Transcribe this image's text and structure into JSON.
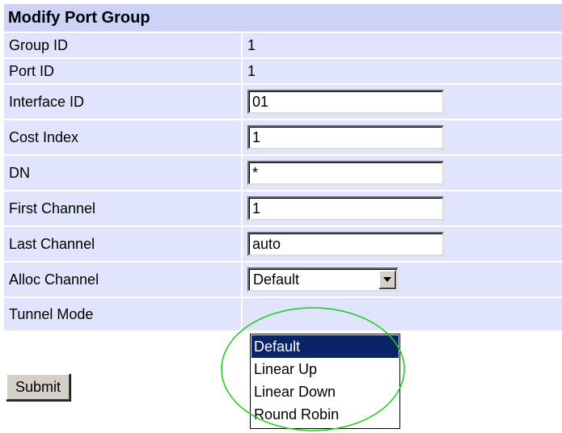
{
  "form": {
    "title": "Modify Port Group",
    "group_id": {
      "label": "Group ID",
      "value": "1"
    },
    "port_id": {
      "label": "Port ID",
      "value": "1"
    },
    "interface_id": {
      "label": "Interface ID",
      "value": "01"
    },
    "cost_index": {
      "label": "Cost Index",
      "value": "1"
    },
    "dn": {
      "label": "DN",
      "value": "*"
    },
    "first_channel": {
      "label": "First Channel",
      "value": "1"
    },
    "last_channel": {
      "label": "Last Channel",
      "value": "auto"
    },
    "alloc_channel": {
      "label": "Alloc Channel",
      "selected": "Default"
    },
    "tunnel_mode": {
      "label": "Tunnel Mode"
    },
    "submit_label": "Submit"
  },
  "dropdown": {
    "options": [
      "Default",
      "Linear Up",
      "Linear Down",
      "Round Robin"
    ],
    "highlighted": "Default"
  },
  "colors": {
    "header_bg": "#ccd3f6",
    "row_bg": "#e0e4fc",
    "selection": "#0a246a",
    "annotation_circle": "#00cc00"
  },
  "icons": {
    "select_arrow": "chevron-down-icon"
  }
}
